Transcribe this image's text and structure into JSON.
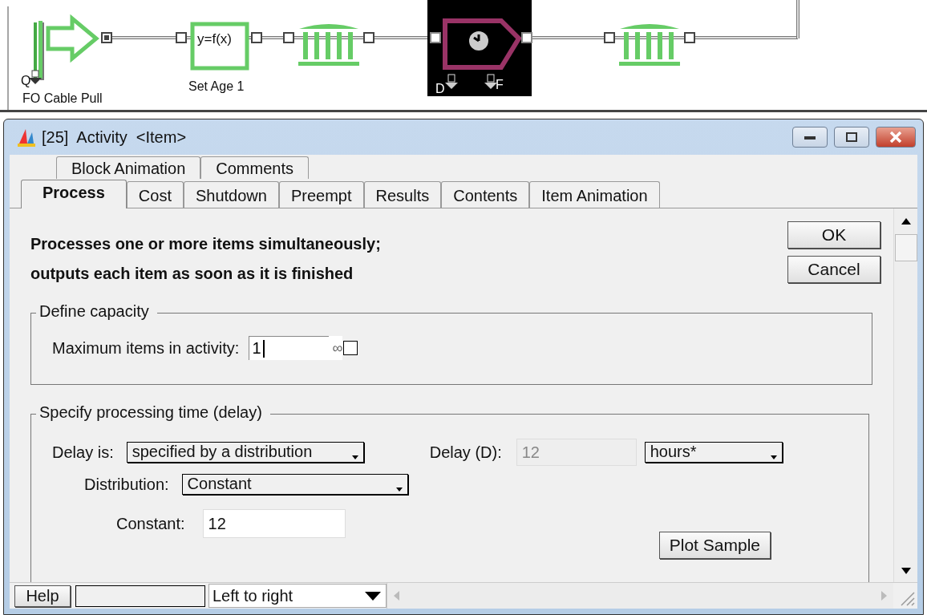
{
  "model": {
    "blocks": [
      {
        "kind": "create",
        "label": "FO Cable Pull",
        "port": "Q",
        "selected": false
      },
      {
        "kind": "equation",
        "label": "Set Age 1",
        "formula": "y=f(x)",
        "selected": false
      },
      {
        "kind": "queue",
        "selected": false
      },
      {
        "kind": "activity",
        "ports": [
          "D",
          "F"
        ],
        "selected": true
      },
      {
        "kind": "queue",
        "selected": false
      }
    ]
  },
  "window": {
    "title": "[25]  Activity  <Item>"
  },
  "tabs_back": [
    {
      "label": "Block Animation",
      "selected": false
    },
    {
      "label": "Comments",
      "selected": false
    }
  ],
  "tabs": [
    {
      "label": "Process",
      "selected": true
    },
    {
      "label": "Cost",
      "selected": false
    },
    {
      "label": "Shutdown",
      "selected": false
    },
    {
      "label": "Preempt",
      "selected": false
    },
    {
      "label": "Results",
      "selected": false
    },
    {
      "label": "Contents",
      "selected": false
    },
    {
      "label": "Item Animation",
      "selected": false
    }
  ],
  "description": [
    "Processes one or more items simultaneously;",
    "outputs each item as soon as it is finished"
  ],
  "buttons": [
    "OK",
    "Cancel"
  ],
  "capacity": {
    "title": "Define capacity",
    "label": "Maximum items in activity:",
    "value": "1",
    "unlimited_symbol": "∞",
    "unlimited_checked": false
  },
  "delay": {
    "title": "Specify processing time (delay)",
    "delay_is": {
      "label": "Delay is:",
      "value": "specified by a distribution"
    },
    "delay_d": {
      "label": "Delay (D):",
      "value": "12",
      "disabled": true
    },
    "units": {
      "value": "hours*"
    },
    "distribution": {
      "label": "Distribution:",
      "value": "Constant"
    },
    "constant": {
      "label": "Constant:",
      "value": "12"
    },
    "plot_button": "Plot Sample"
  },
  "footer": {
    "help": "Help",
    "direction": "Left to right"
  }
}
